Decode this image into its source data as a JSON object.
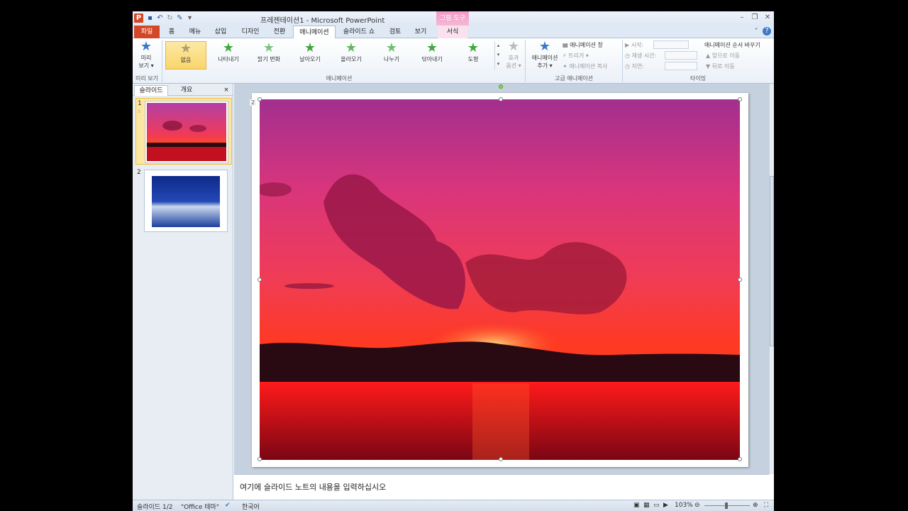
{
  "title_bar": {
    "window_title": "프레젠테이션1  -  Microsoft PowerPoint",
    "context_tab_group": "그림 도구",
    "app_logo": "P"
  },
  "tabs": [
    {
      "label": "파일"
    },
    {
      "label": "홈"
    },
    {
      "label": "메뉴"
    },
    {
      "label": "삽입"
    },
    {
      "label": "디자인"
    },
    {
      "label": "전환"
    },
    {
      "label": "애니메이션"
    },
    {
      "label": "슬라이드 쇼"
    },
    {
      "label": "검토"
    },
    {
      "label": "보기"
    },
    {
      "label": "서식"
    }
  ],
  "ribbon": {
    "preview": {
      "label1": "미리",
      "label2": "보기 ▾",
      "group": "미리 보기"
    },
    "animations": [
      {
        "label": "없음"
      },
      {
        "label": "나타내기"
      },
      {
        "label": "밝기 변화"
      },
      {
        "label": "날아오기"
      },
      {
        "label": "올라오기"
      },
      {
        "label": "나누기"
      },
      {
        "label": "닦아내기"
      },
      {
        "label": "도형"
      }
    ],
    "animation_group": "애니메이션",
    "effect_options": {
      "label1": "효과",
      "label2": "옵션 ▾"
    },
    "add_animation": {
      "label1": "애니메이션",
      "label2": "추가 ▾"
    },
    "advanced": {
      "pane": "애니메이션 창",
      "trigger": "트리거 ▾",
      "painter": "애니메이션 복사",
      "group": "고급 애니메이션"
    },
    "timing": {
      "start": "시작:",
      "duration": "재생 시간:",
      "delay": "지연:",
      "reorder": "애니메이션 순서 바꾸기",
      "move_earlier": "앞으로 이동",
      "move_later": "뒤로 이동",
      "group": "타이밍"
    }
  },
  "left_pane": {
    "tab_slides": "슬라이드",
    "tab_outline": "개요",
    "close": "×",
    "thumbnails": [
      {
        "number": "1"
      },
      {
        "number": "2"
      }
    ]
  },
  "slide": {
    "tag": "2"
  },
  "notes": {
    "placeholder": "여기에 슬라이드 노트의 내용을 입력하십시오"
  },
  "status": {
    "slide_info": "슬라이드 1/2",
    "theme": "\"Office 테마\"",
    "language": "한국어",
    "zoom": "103%"
  },
  "colors": {
    "file_tab": "#d24726",
    "context_tab": "#f39bc7",
    "selected_item": "#f9d56a"
  }
}
